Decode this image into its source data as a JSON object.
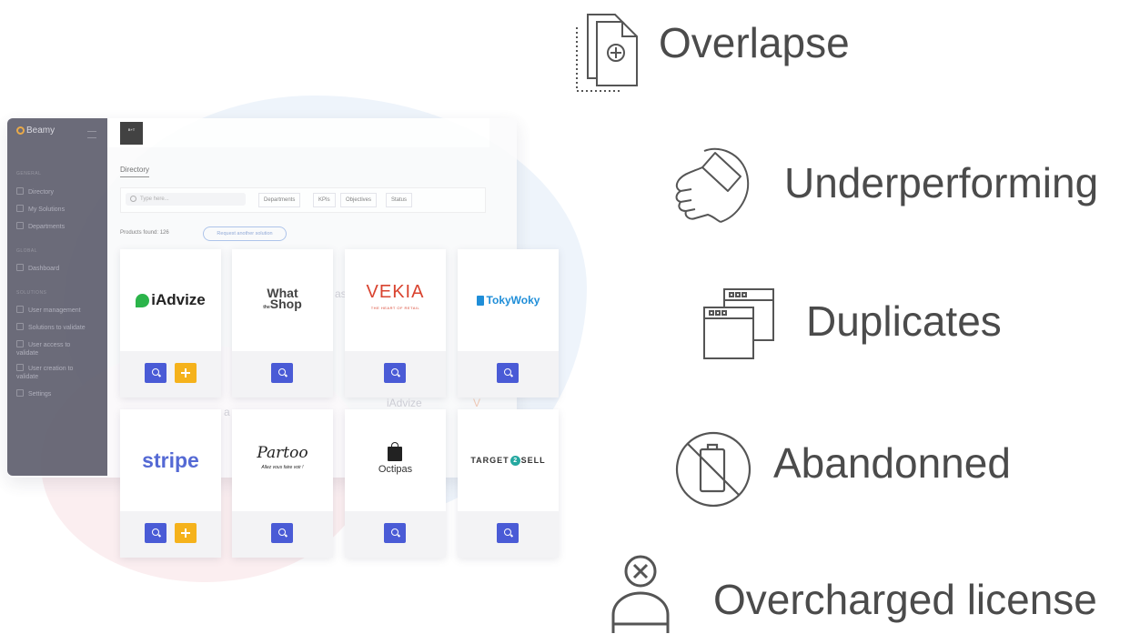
{
  "app": {
    "brand": "Beamy",
    "avatar_text": "B+T",
    "sidebar": {
      "sections": [
        "GENERAL",
        "GLOBAL",
        "SOLUTIONS"
      ],
      "items": [
        "Directory",
        "My Solutions",
        "Departments",
        "Dashboard",
        "User management",
        "Solutions to validate",
        "User access to validate",
        "User creation to validate",
        "Settings"
      ]
    },
    "directory": {
      "title": "Directory",
      "search_placeholder": "Type here...",
      "filters": [
        "Departments",
        "KPIs",
        "Objectives",
        "Status"
      ],
      "products_found": "Products found: 126",
      "request_button": "Request another solution"
    },
    "products": [
      {
        "name": "iAdvize",
        "add": true
      },
      {
        "name": "What the Shop",
        "line1": "What",
        "line2": "the",
        "line3": "Shop",
        "add": false
      },
      {
        "name": "VEKIA",
        "display": "VEKIA",
        "tagline": "THE HEART OF RETAIL",
        "add": false
      },
      {
        "name": "TokyWoky",
        "add": false
      },
      {
        "name": "stripe",
        "add": true
      },
      {
        "name": "Partoo",
        "tagline": "Allez vous faire voir !",
        "add": false
      },
      {
        "name": "Octipas",
        "add": false
      },
      {
        "name": "TARGET2SELL",
        "left": "TARGET",
        "mid": "2",
        "right": "SELL",
        "add": false
      }
    ],
    "ghost_texts": [
      "iAdvize",
      "V",
      "as",
      "a"
    ],
    "colors": {
      "search_button": "#4a5bd6",
      "add_button": "#f5b21c",
      "sidebar": "#5f5f6e"
    }
  },
  "issues": [
    {
      "label": "Overlapse",
      "icon": "overlapping-documents-icon"
    },
    {
      "label": "Underperforming",
      "icon": "thumbs-down-icon"
    },
    {
      "label": "Duplicates",
      "icon": "duplicate-windows-icon"
    },
    {
      "label": "Abandonned",
      "icon": "no-phone-icon"
    },
    {
      "label": "Overcharged license",
      "icon": "user-remove-icon"
    }
  ]
}
